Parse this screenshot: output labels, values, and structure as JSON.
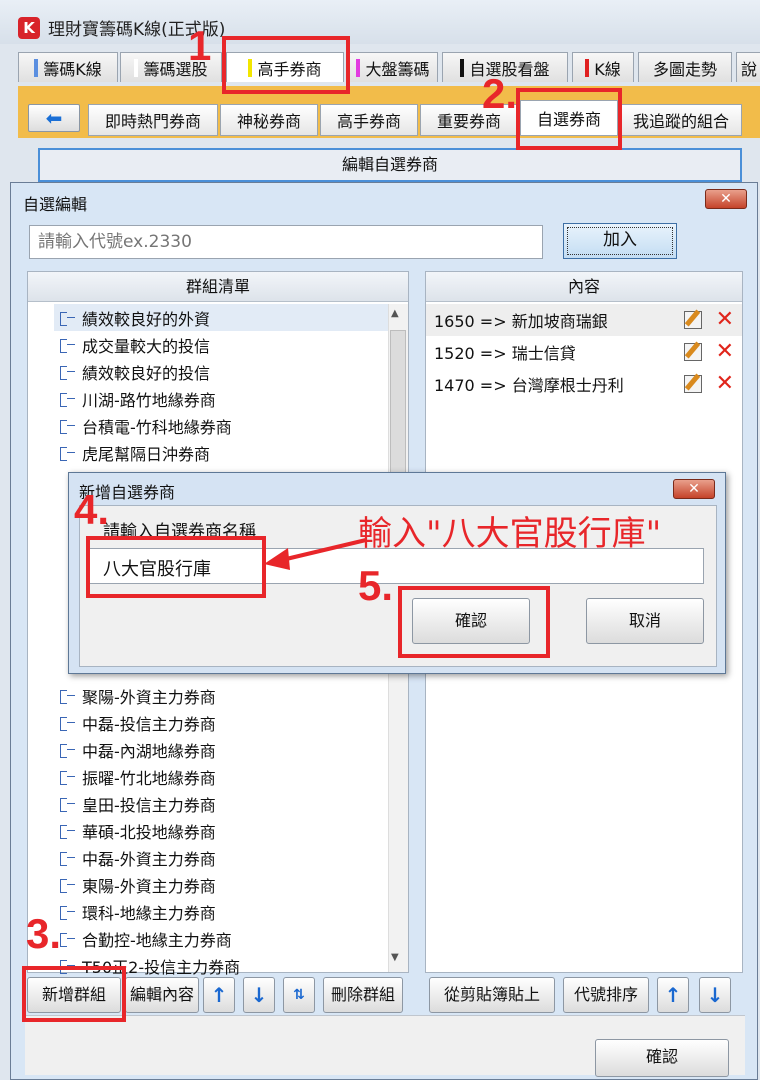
{
  "app": {
    "icon_letter": "K",
    "title": "理財寶籌碼K線(正式版)"
  },
  "main_tabs": [
    {
      "label": "籌碼K線",
      "color": "#5b8fe0"
    },
    {
      "label": "籌碼選股",
      "color": "#ffffff"
    },
    {
      "label": "高手券商",
      "color": "#f2e600"
    },
    {
      "label": "大盤籌碼",
      "color": "#e23be0"
    },
    {
      "label": "自選股看盤",
      "color": "#111111"
    },
    {
      "label": "K線",
      "color": "#e02020"
    },
    {
      "label": "多圖走勢",
      "color": ""
    },
    {
      "label": "說",
      "color": ""
    }
  ],
  "sub_tabs": {
    "back_icon": "left-arrow-icon",
    "items": [
      "即時熱門券商",
      "神秘券商",
      "高手券商",
      "重要券商",
      "自選券商",
      "我追蹤的組合"
    ]
  },
  "edit_strip_label": "編輯自選券商",
  "editor": {
    "title": "自選編輯",
    "close_label": "✕",
    "code_placeholder": "請輸入代號ex.2330",
    "add_label": "加入",
    "groups_header": "群組清單",
    "content_header": "內容",
    "groups": [
      "績效較良好的外資",
      "成交量較大的投信",
      "績效較良好的投信",
      "川湖-路竹地緣券商",
      "台積電-竹科地緣券商",
      "虎尾幫隔日沖券商",
      "聚陽-外資主力券商",
      "中磊-投信主力券商",
      "中磊-內湖地緣券商",
      "振曜-竹北地緣券商",
      "皇田-投信主力券商",
      "華碩-北投地緣券商",
      "中磊-外資主力券商",
      "東陽-外資主力券商",
      "環科-地緣主力券商",
      "合勤控-地緣主力券商",
      "T50正2-投信主力券商"
    ],
    "contents": [
      "1650 => 新加坡商瑞銀",
      "1520 => 瑞士信貸",
      "1470 => 台灣摩根士丹利"
    ],
    "left_buttons": {
      "new_group": "新增群組",
      "edit_content": "編輯內容",
      "delete_group": "刪除群組"
    },
    "right_buttons": {
      "paste": "從剪貼簿貼上",
      "sort": "代號排序"
    },
    "confirm_label": "確認"
  },
  "add_dialog": {
    "title": "新增自選券商",
    "close_label": "✕",
    "prompt": "請輸入自選券商名稱",
    "value": "八大官股行庫",
    "ok_label": "確認",
    "cancel_label": "取消"
  },
  "annotations": {
    "step1": "1",
    "step2": "2.",
    "step3": "3.",
    "step4": "4.",
    "step5": "5.",
    "callout": "輸入\"八大官股行庫\"",
    "color": "#e8262a"
  }
}
